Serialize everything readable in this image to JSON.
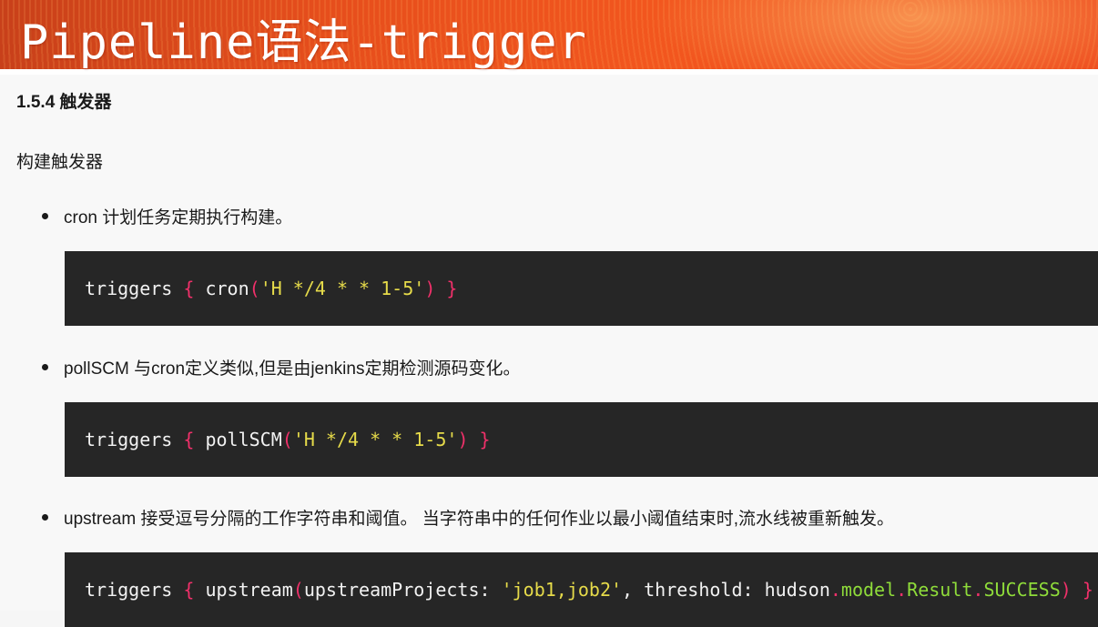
{
  "banner": {
    "title": "Pipeline语法-trigger"
  },
  "section": {
    "heading": "1.5.4 触发器",
    "intro": "构建触发器"
  },
  "items": [
    {
      "text": "cron 计划任务定期执行构建。",
      "code": {
        "keyword": "triggers",
        "open": "{",
        "func": "cron",
        "paren_open": "(",
        "arg": "'H */4 * * 1-5'",
        "paren_close": ")",
        "close": "}"
      }
    },
    {
      "text": "pollSCM 与cron定义类似,但是由jenkins定期检测源码变化。",
      "code": {
        "keyword": "triggers",
        "open": "{",
        "func": "pollSCM",
        "paren_open": "(",
        "arg": "'H */4 * * 1-5'",
        "paren_close": ")",
        "close": "}"
      }
    },
    {
      "text": "upstream 接受逗号分隔的工作字符串和阈值。 当字符串中的任何作业以最小阈值结束时,流水线被重新触发。",
      "code": {
        "keyword": "triggers",
        "open": "{",
        "func": "upstream",
        "paren_open": "(",
        "param1": "upstreamProjects:",
        "arg": "'job1,job2'",
        "comma": ",",
        "param2": "threshold:",
        "obj": "hudson",
        "dot1": ".",
        "model": "model",
        "dot2": ".",
        "result": "Result",
        "dot3": ".",
        "success": "SUCCESS",
        "paren_close": ")",
        "close": "}"
      }
    }
  ],
  "colors": {
    "banner_bg": "#ee4e1c",
    "code_bg": "#262626",
    "brace": "#f0306a",
    "string": "#e6db4a",
    "member": "#8fdc3a"
  }
}
